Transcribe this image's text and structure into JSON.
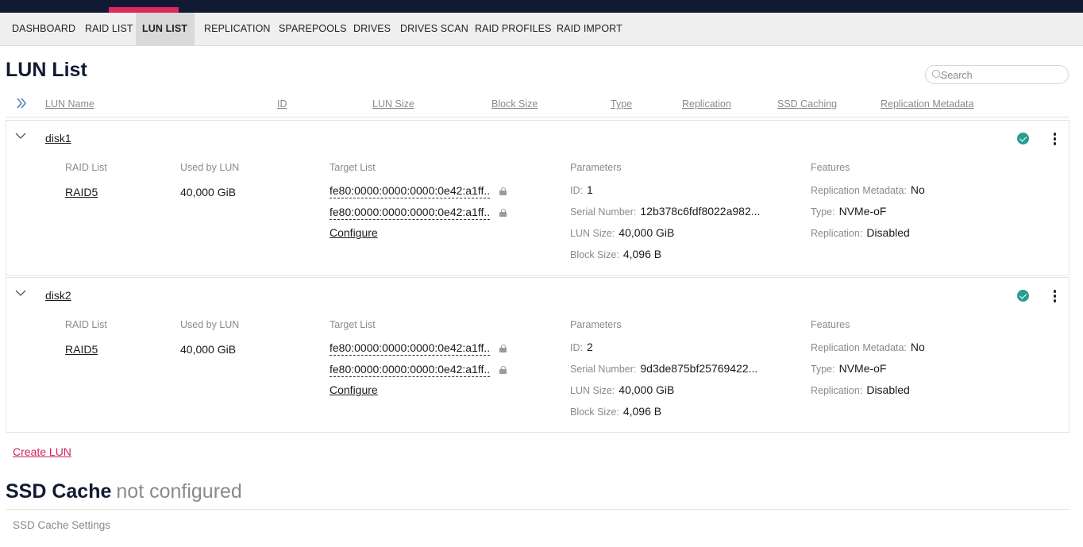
{
  "nav": {
    "items": [
      "DASHBOARD",
      "RAID LIST",
      "LUN LIST",
      "REPLICATION",
      "SPAREPOOLS",
      "DRIVES",
      "DRIVES SCAN",
      "RAID PROFILES",
      "RAID IMPORT"
    ],
    "active": "LUN LIST"
  },
  "page": {
    "title": "LUN List"
  },
  "search": {
    "placeholder": "Search"
  },
  "table": {
    "columns": [
      "LUN Name",
      "ID",
      "LUN Size",
      "Block Size",
      "Type",
      "Replication",
      "SSD Caching",
      "Replication Metadata"
    ],
    "detail_headers": {
      "raid_list": "RAID List",
      "used_by_lun": "Used by LUN",
      "target_list": "Target List",
      "parameters": "Parameters",
      "features": "Features"
    },
    "param_labels": {
      "id": "ID:",
      "serial": "Serial Number:",
      "lun_size": "LUN Size:",
      "block_size": "Block Size:"
    },
    "feature_labels": {
      "repl_meta": "Replication Metadata:",
      "type": "Type:",
      "replication": "Replication:"
    },
    "configure_label": "Configure",
    "rows": [
      {
        "name": "disk1",
        "raid": "RAID5",
        "used": "40,000 GiB",
        "targets": [
          "fe80:0000:0000:0000:0e42:a1ff..",
          "fe80:0000:0000:0000:0e42:a1ff.."
        ],
        "id": "1",
        "serial": "12b378c6fdf8022a982...",
        "lun_size": "40,000 GiB",
        "block_size": "4,096 B",
        "repl_meta": "No",
        "type": "NVMe-oF",
        "replication": "Disabled"
      },
      {
        "name": "disk2",
        "raid": "RAID5",
        "used": "40,000 GiB",
        "targets": [
          "fe80:0000:0000:0000:0e42:a1ff..",
          "fe80:0000:0000:0000:0e42:a1ff.."
        ],
        "id": "2",
        "serial": "9d3de875bf25769422...",
        "lun_size": "40,000 GiB",
        "block_size": "4,096 B",
        "repl_meta": "No",
        "type": "NVMe-oF",
        "replication": "Disabled"
      }
    ]
  },
  "actions": {
    "create_lun": "Create LUN"
  },
  "ssd_cache": {
    "title": "SSD Cache",
    "status": "not configured",
    "settings_label": "SSD Cache Settings"
  },
  "colors": {
    "topbar": "#121a33",
    "accent": "#e0285f",
    "link_accent": "#d2245a",
    "status_ok": "#2a9d8f"
  },
  "icons": [
    "search-icon",
    "expand-all-icon",
    "chevron-down-icon",
    "status-ok-icon",
    "more-vert-icon",
    "lock-icon"
  ]
}
